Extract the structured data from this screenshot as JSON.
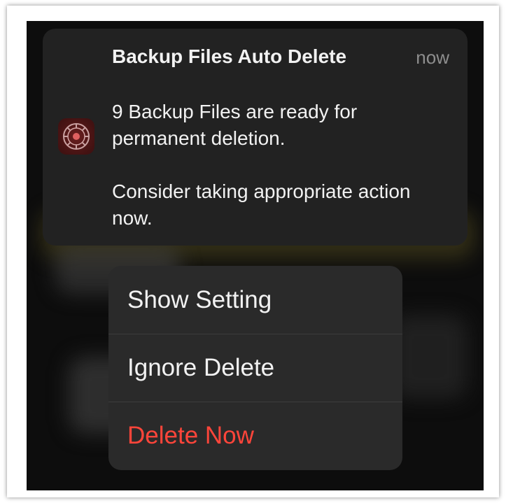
{
  "notification": {
    "icon": "backup-app-icon",
    "title": "Backup Files Auto Delete",
    "time": "now",
    "body_line1": "9 Backup Files are ready for permanent deletion.",
    "body_line2": "Consider taking appropriate action now."
  },
  "menu": {
    "items": [
      {
        "label": "Show Setting",
        "style": "default"
      },
      {
        "label": "Ignore Delete",
        "style": "default"
      },
      {
        "label": "Delete Now",
        "style": "destructive"
      }
    ]
  },
  "colors": {
    "destructive": "#ff453a",
    "card_bg": "#222222",
    "menu_bg": "#2a2a2a",
    "text": "#f2f2f2",
    "secondary_text": "#8e8e8e"
  }
}
